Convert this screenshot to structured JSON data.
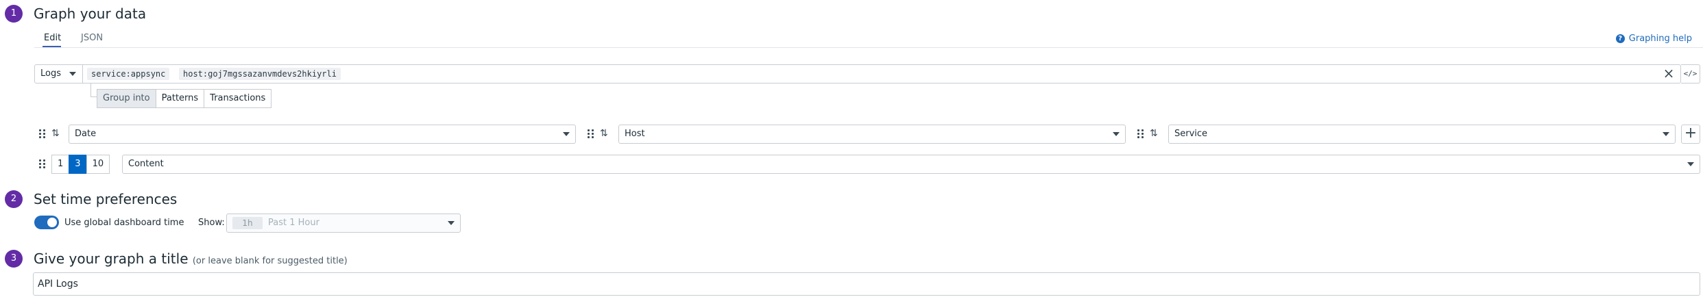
{
  "steps": [
    {
      "number": "1",
      "title": "Graph your data",
      "note": ""
    },
    {
      "number": "2",
      "title": "Set time preferences",
      "note": ""
    },
    {
      "number": "3",
      "title": "Give your graph a title",
      "note": "(or leave blank for suggested title)"
    }
  ],
  "tabs": [
    {
      "label": "Edit",
      "active": true
    },
    {
      "label": "JSON",
      "active": false
    }
  ],
  "help": {
    "label": "Graphing help",
    "icon": "question-circle-icon"
  },
  "query": {
    "source": "Logs",
    "tags": [
      "service:appsync",
      "host:goj7mgssazanvmdevs2hkiyrli"
    ]
  },
  "group_into": {
    "options": [
      "Group into",
      "Patterns",
      "Transactions"
    ],
    "selected": "Group into"
  },
  "columns": [
    {
      "value": "Date"
    },
    {
      "value": "Host"
    },
    {
      "value": "Service"
    }
  ],
  "message": {
    "sizes": [
      "1",
      "3",
      "10"
    ],
    "selected_size": "3",
    "column": "Content"
  },
  "time": {
    "global_toggle_label": "Use global dashboard time",
    "global_enabled": true,
    "show_label": "Show:",
    "badge": "1h",
    "range": "Past 1 Hour"
  },
  "title": {
    "value": "API Logs"
  },
  "colors": {
    "accent": "#632ca6",
    "primary": "#1f6bbd",
    "active_size": "#0067c4"
  }
}
